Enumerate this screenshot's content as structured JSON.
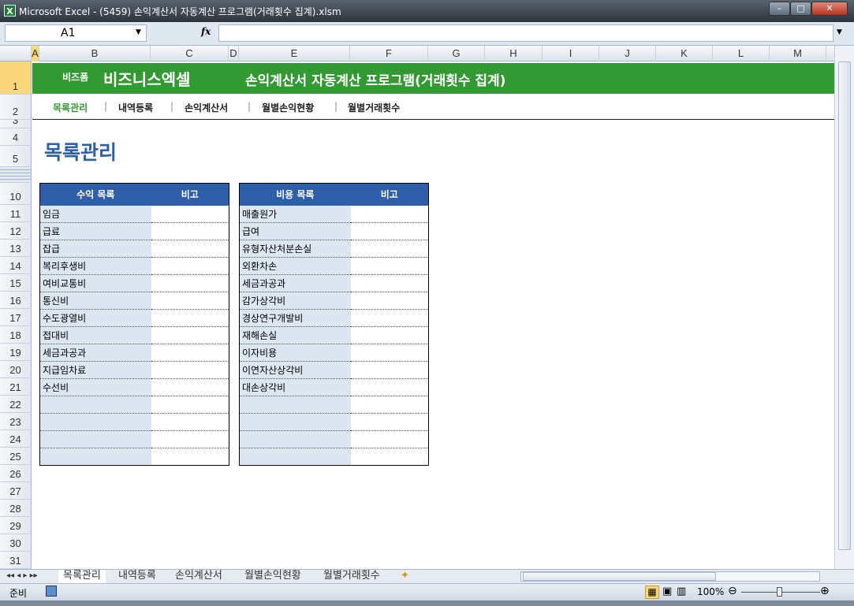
{
  "window": {
    "title": "Microsoft Excel - (5459) 손익계산서 자동계산 프로그램(거래횟수 집계).xlsm",
    "app_icon": "X"
  },
  "formula_bar": {
    "name_box": "A1",
    "fx": "fx",
    "value": ""
  },
  "columns": [
    "A",
    "B",
    "C",
    "D",
    "E",
    "F",
    "G",
    "H",
    "I",
    "J",
    "K",
    "L",
    "M"
  ],
  "rows": [
    "1",
    "2",
    "3",
    "4",
    "5",
    "10",
    "11",
    "12",
    "13",
    "14",
    "15",
    "16",
    "17",
    "18",
    "19",
    "20",
    "21",
    "22",
    "23",
    "24",
    "25",
    "26",
    "27",
    "28",
    "29",
    "30",
    "31"
  ],
  "banner": {
    "brand_small": "비즈폼",
    "brand": "비즈니스엑셀",
    "title": "손익계산서 자동계산 프로그램(거래횟수 집계)"
  },
  "nav": {
    "items": [
      "목록관리",
      "내역등록",
      "손익계산서",
      "월별손익현황",
      "월별거래횟수"
    ],
    "separator": "|",
    "active_color": "#339933"
  },
  "page_title": "목록관리",
  "income_table": {
    "headers": [
      "수익 목록",
      "비고"
    ],
    "items": [
      "임금",
      "급료",
      "잡급",
      "복리후생비",
      "여비교통비",
      "통신비",
      "수도광열비",
      "접대비",
      "세금과공과",
      "지급임차료",
      "수선비",
      "",
      "",
      "",
      ""
    ]
  },
  "expense_table": {
    "headers": [
      "비용 목록",
      "비고"
    ],
    "items": [
      "매출원가",
      "급여",
      "유형자산처분손실",
      "외환차손",
      "세금과공과",
      "감가상각비",
      "경상연구개발비",
      "재해손실",
      "이자비용",
      "이연자산상각비",
      "대손상각비",
      "",
      "",
      "",
      ""
    ]
  },
  "sheet_tabs": [
    "목록관리",
    "내역등록",
    "손익계산서",
    "월별손익현황",
    "월별거래횟수"
  ],
  "status": {
    "ready": "준비",
    "zoom": "100%"
  }
}
